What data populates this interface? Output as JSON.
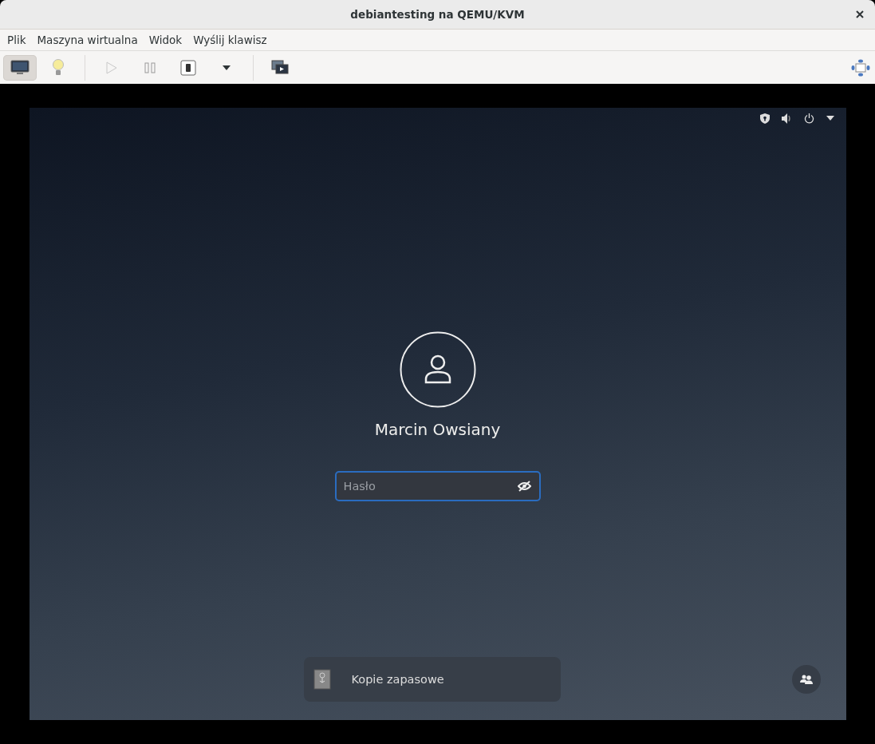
{
  "window": {
    "title": "debiantesting na QEMU/KVM"
  },
  "menu": [
    "Plik",
    "Maszyna wirtualna",
    "Widok",
    "Wyślij klawisz"
  ],
  "toolbar": [
    {
      "kind": "console",
      "selected": true
    },
    {
      "kind": "details",
      "selected": false
    },
    {
      "kind": "separator"
    },
    {
      "kind": "run",
      "selected": false
    },
    {
      "kind": "pause",
      "selected": false
    },
    {
      "kind": "shutdown",
      "selected": false
    },
    {
      "kind": "caret",
      "selected": false
    },
    {
      "kind": "separator"
    },
    {
      "kind": "snapshots",
      "selected": false
    }
  ],
  "login": {
    "user_name": "Marcin Owsiany",
    "password": {
      "placeholder": "Hasło"
    }
  },
  "notification": {
    "label": "Kopie zapasowe"
  }
}
